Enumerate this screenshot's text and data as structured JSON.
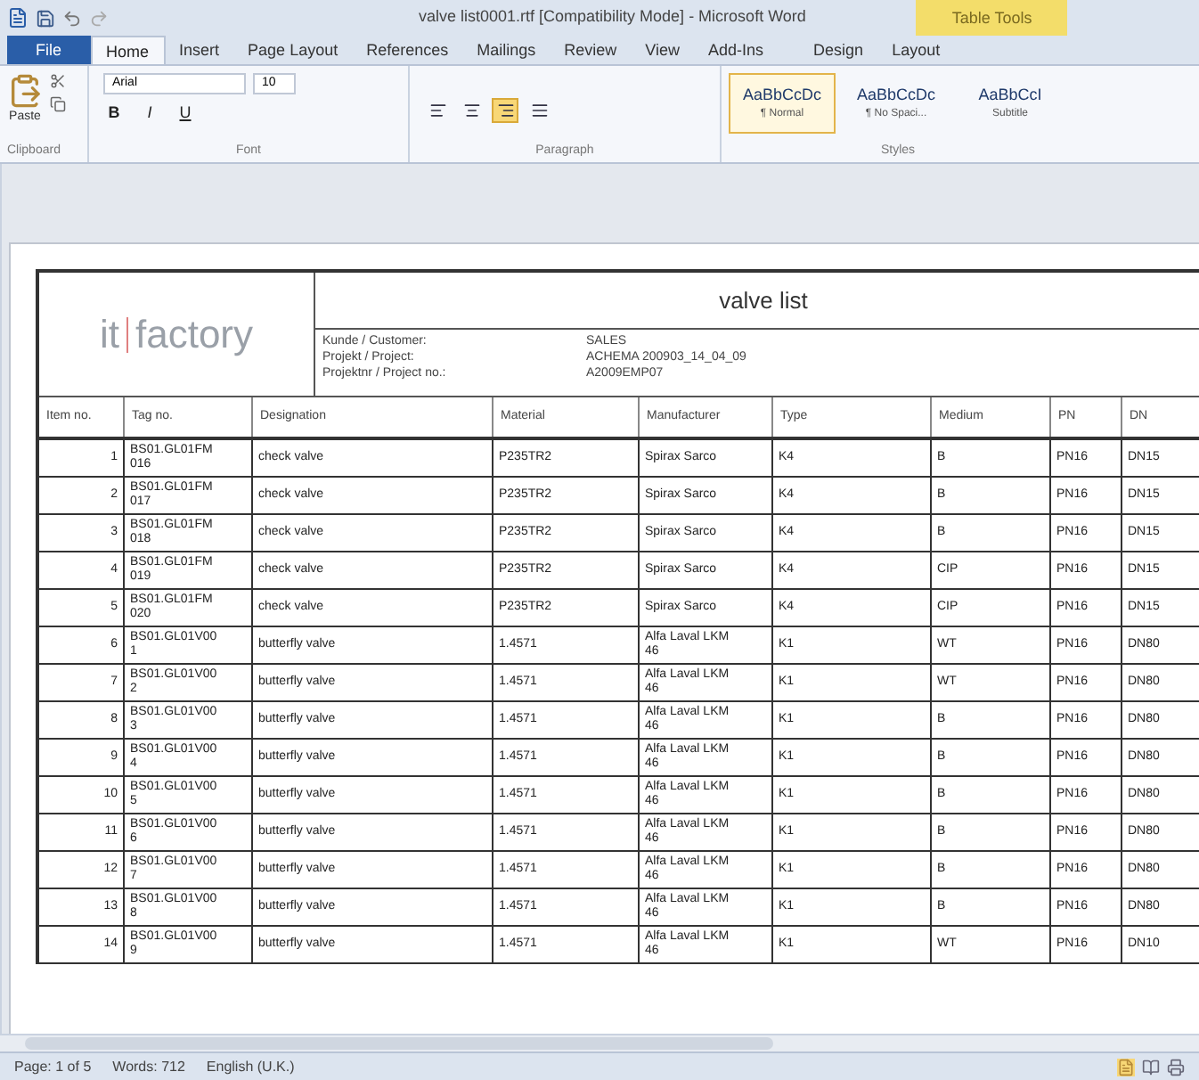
{
  "window": {
    "title": "valve list0001.rtf [Compatibility Mode] - Microsoft Word",
    "context_tab": "Table Tools"
  },
  "tabs": [
    {
      "label": "File",
      "kind": "file",
      "selected": false
    },
    {
      "label": "Home",
      "kind": "tab",
      "selected": true
    },
    {
      "label": "Insert",
      "kind": "tab",
      "selected": false
    },
    {
      "label": "Page Layout",
      "kind": "tab",
      "selected": false
    },
    {
      "label": "References",
      "kind": "tab",
      "selected": false
    },
    {
      "label": "Mailings",
      "kind": "tab",
      "selected": false
    },
    {
      "label": "Review",
      "kind": "tab",
      "selected": false
    },
    {
      "label": "View",
      "kind": "tab",
      "selected": false
    },
    {
      "label": "Add-Ins",
      "kind": "tab",
      "selected": false
    },
    {
      "label": "Design",
      "kind": "context",
      "selected": false
    },
    {
      "label": "Layout",
      "kind": "context",
      "selected": false
    }
  ],
  "ribbon": {
    "paste_label": "Paste",
    "font_name": "Arial",
    "font_size": "10",
    "format_buttons": [
      "B",
      "I",
      "U"
    ],
    "align": [
      {
        "kind": "left",
        "selected": false
      },
      {
        "kind": "center",
        "selected": false
      },
      {
        "kind": "right",
        "selected": true
      },
      {
        "kind": "justify",
        "selected": false
      }
    ],
    "styles": [
      {
        "sample": "AaBbCcDc",
        "label": "¶ Normal",
        "selected": true
      },
      {
        "sample": "AaBbCcDc",
        "label": "¶ No Spaci...",
        "selected": false
      },
      {
        "sample": "AaBbCcI",
        "label": "Subtitle",
        "selected": false
      }
    ],
    "groups": [
      "Clipboard",
      "Font",
      "Paragraph",
      "Styles"
    ]
  },
  "document": {
    "logo": [
      "it",
      "factory"
    ],
    "title": "valve list",
    "info": [
      {
        "label": "Kunde / Customer:",
        "value": "SALES"
      },
      {
        "label": "Projekt / Project:",
        "value": "ACHEMA 200903_14_04_09"
      },
      {
        "label": "Projektnr / Project no.:",
        "value": "A2009EMP07"
      }
    ],
    "columns": [
      "Item no.",
      "Tag no.",
      "Designation",
      "Material",
      "Manufacturer",
      "Type",
      "Medium",
      "PN",
      "DN"
    ],
    "rows": [
      [
        "1",
        "BS01.GL01FM\n016",
        "check valve",
        "P235TR2",
        "Spirax Sarco",
        "K4",
        "B",
        "PN16",
        "DN15"
      ],
      [
        "2",
        "BS01.GL01FM\n017",
        "check valve",
        "P235TR2",
        "Spirax Sarco",
        "K4",
        "B",
        "PN16",
        "DN15"
      ],
      [
        "3",
        "BS01.GL01FM\n018",
        "check valve",
        "P235TR2",
        "Spirax Sarco",
        "K4",
        "B",
        "PN16",
        "DN15"
      ],
      [
        "4",
        "BS01.GL01FM\n019",
        "check valve",
        "P235TR2",
        "Spirax Sarco",
        "K4",
        "CIP",
        "PN16",
        "DN15"
      ],
      [
        "5",
        "BS01.GL01FM\n020",
        "check valve",
        "P235TR2",
        "Spirax Sarco",
        "K4",
        "CIP",
        "PN16",
        "DN15"
      ],
      [
        "6",
        "BS01.GL01V00\n1",
        "butterfly valve",
        "1.4571",
        "Alfa Laval LKM\n46",
        "K1",
        "WT",
        "PN16",
        "DN80"
      ],
      [
        "7",
        "BS01.GL01V00\n2",
        "butterfly valve",
        "1.4571",
        "Alfa Laval LKM\n46",
        "K1",
        "WT",
        "PN16",
        "DN80"
      ],
      [
        "8",
        "BS01.GL01V00\n3",
        "butterfly valve",
        "1.4571",
        "Alfa Laval LKM\n46",
        "K1",
        "B",
        "PN16",
        "DN80"
      ],
      [
        "9",
        "BS01.GL01V00\n4",
        "butterfly valve",
        "1.4571",
        "Alfa Laval LKM\n46",
        "K1",
        "B",
        "PN16",
        "DN80"
      ],
      [
        "10",
        "BS01.GL01V00\n5",
        "butterfly valve",
        "1.4571",
        "Alfa Laval LKM\n46",
        "K1",
        "B",
        "PN16",
        "DN80"
      ],
      [
        "11",
        "BS01.GL01V00\n6",
        "butterfly valve",
        "1.4571",
        "Alfa Laval LKM\n46",
        "K1",
        "B",
        "PN16",
        "DN80"
      ],
      [
        "12",
        "BS01.GL01V00\n7",
        "butterfly valve",
        "1.4571",
        "Alfa Laval LKM\n46",
        "K1",
        "B",
        "PN16",
        "DN80"
      ],
      [
        "13",
        "BS01.GL01V00\n8",
        "butterfly valve",
        "1.4571",
        "Alfa Laval LKM\n46",
        "K1",
        "B",
        "PN16",
        "DN80"
      ],
      [
        "14",
        "BS01.GL01V00\n9",
        "butterfly valve",
        "1.4571",
        "Alfa Laval LKM\n46",
        "K1",
        "WT",
        "PN16",
        "DN10"
      ]
    ]
  },
  "status_bar": [
    "Page: 1 of 5",
    "Words: 712",
    "English (U.K.)"
  ]
}
